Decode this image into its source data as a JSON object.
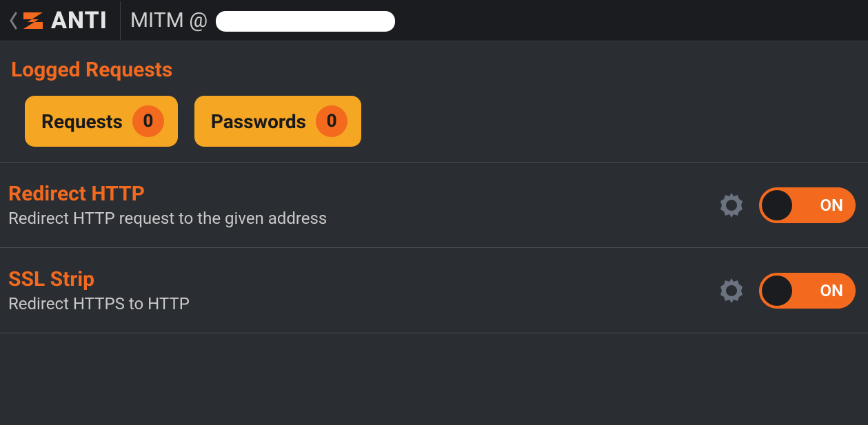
{
  "header": {
    "app_name": "ANTI",
    "title_prefix": "MITM @ "
  },
  "logged": {
    "section_title": "Logged Requests",
    "requests": {
      "label": "Requests",
      "count": "0"
    },
    "passwords": {
      "label": "Passwords",
      "count": "0"
    }
  },
  "settings": [
    {
      "title": "Redirect HTTP",
      "desc": "Redirect HTTP request to the given address",
      "state": "ON"
    },
    {
      "title": "SSL Strip",
      "desc": "Redirect HTTPS to HTTP",
      "state": "ON"
    }
  ]
}
